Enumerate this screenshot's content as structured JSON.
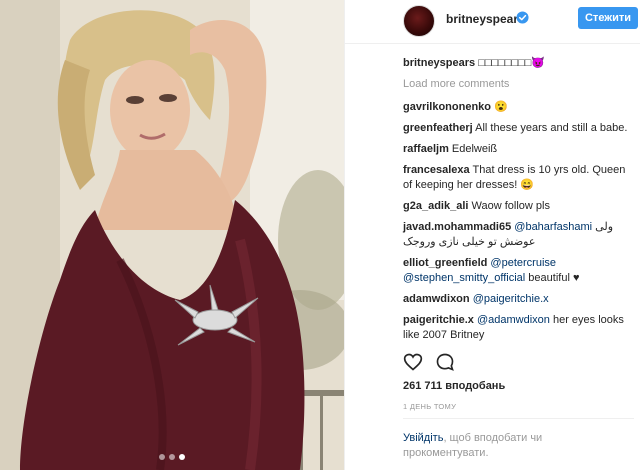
{
  "header": {
    "username": "britneyspears",
    "follow_label": "Стежити"
  },
  "caption": {
    "user": "britneyspears",
    "text": "□□□□□□□□😈"
  },
  "load_more_label": "Load more comments",
  "comments": [
    {
      "user": "gavrilkononenko",
      "parts": [
        {
          "text": " 😮"
        }
      ]
    },
    {
      "user": "greenfeatherj",
      "parts": [
        {
          "text": " All these years and still a babe."
        }
      ]
    },
    {
      "user": "raffaeljm",
      "parts": [
        {
          "text": " Edelweiß"
        }
      ]
    },
    {
      "user": "francesalexa",
      "parts": [
        {
          "text": " That dress is 10 yrs old. Queen of keeping her dresses! 😄"
        }
      ]
    },
    {
      "user": "g2a_adik_ali",
      "parts": [
        {
          "text": " Waow follow pls"
        }
      ]
    },
    {
      "user": "javad.mohammadi65",
      "parts": [
        {
          "text": " "
        },
        {
          "text": "@baharfashami",
          "mention": true
        },
        {
          "text": " ولی عوضش تو خیلی نازی وروجک"
        }
      ]
    },
    {
      "user": "elliot_greenfield",
      "parts": [
        {
          "text": " "
        },
        {
          "text": "@petercruise",
          "mention": true
        },
        {
          "text": " "
        },
        {
          "text": "@stephen_smitty_official",
          "mention": true
        },
        {
          "text": " beautiful ♥"
        }
      ]
    },
    {
      "user": "adamwdixon",
      "parts": [
        {
          "text": " "
        },
        {
          "text": "@paigeritchie.x",
          "mention": true
        }
      ]
    },
    {
      "user": "paigeritchie.x",
      "parts": [
        {
          "text": " "
        },
        {
          "text": "@adamwdixon",
          "mention": true
        },
        {
          "text": " her eyes looks like 2007 Britney"
        }
      ]
    }
  ],
  "likes_text": "261 711 вподобань",
  "timestamp": "1 ДЕНЬ ТОМУ",
  "login_prompt": {
    "link": "Увійдіть",
    "rest": ", щоб вподобати чи прокоментувати."
  },
  "carousel": {
    "count": 3,
    "active_index": 2
  },
  "icons": [
    "verified-badge-icon",
    "heart-icon",
    "comment-icon"
  ],
  "colors": {
    "accent": "#3897f0",
    "mention": "#003569",
    "muted": "#999999",
    "dress": "#5a1a24"
  }
}
